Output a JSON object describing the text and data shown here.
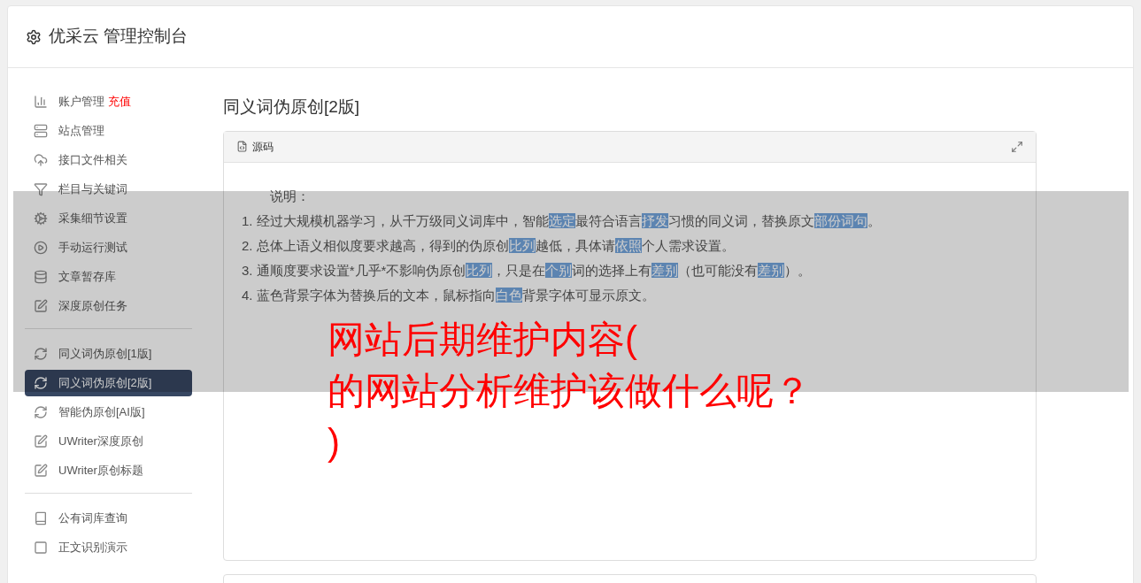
{
  "header": {
    "title": "优采云 管理控制台"
  },
  "sidebar": {
    "groups": [
      [
        {
          "kind": "chart",
          "label": "账户管理",
          "badge": "充值",
          "selected": false
        },
        {
          "kind": "server",
          "label": "站点管理",
          "selected": false
        },
        {
          "kind": "cloud",
          "label": "接口文件相关",
          "selected": false
        },
        {
          "kind": "filter",
          "label": "栏目与关键词",
          "selected": false
        },
        {
          "kind": "gears",
          "label": "采集细节设置",
          "selected": false
        },
        {
          "kind": "play",
          "label": "手动运行测试",
          "selected": false
        },
        {
          "kind": "database",
          "label": "文章暂存库",
          "selected": false
        },
        {
          "kind": "edit",
          "label": "深度原创任务",
          "selected": false
        }
      ],
      [
        {
          "kind": "refresh",
          "label": "同义词伪原创[1版]",
          "selected": false
        },
        {
          "kind": "refresh",
          "label": "同义词伪原创[2版]",
          "selected": true
        },
        {
          "kind": "refresh",
          "label": "智能伪原创[AI版]",
          "selected": false
        },
        {
          "kind": "edit",
          "label": "UWriter深度原创",
          "selected": false
        },
        {
          "kind": "edit",
          "label": "UWriter原创标题",
          "selected": false
        }
      ],
      [
        {
          "kind": "book",
          "label": "公有词库查询",
          "selected": false
        },
        {
          "kind": "square",
          "label": "正文识别演示",
          "selected": false
        }
      ]
    ]
  },
  "main": {
    "title": "同义词伪原创[2版]",
    "panel": {
      "tab": "源码",
      "heading": "说明：",
      "lines": [
        [
          {
            "text": "1. 经过大规模机器学习，从千万级同义词库中，智能",
            "highlighted": false
          },
          {
            "text": "选定",
            "highlighted": true
          },
          {
            "text": "最符合语言",
            "highlighted": false
          },
          {
            "text": "抒发",
            "highlighted": true
          },
          {
            "text": "习惯的同义词，替换原文",
            "highlighted": false
          },
          {
            "text": "部份",
            "highlighted": true
          },
          {
            "text": "词句",
            "highlighted": true
          },
          {
            "text": "。",
            "highlighted": false
          }
        ],
        [
          {
            "text": "2. 总体上语义相似度要求越高，得到的伪原创",
            "highlighted": false
          },
          {
            "text": "比列",
            "highlighted": true
          },
          {
            "text": "越低，具体请",
            "highlighted": false
          },
          {
            "text": "依照",
            "highlighted": true
          },
          {
            "text": "个人需求设置。",
            "highlighted": false
          }
        ],
        [
          {
            "text": "3. 通顺度要求设置*几乎*不影响伪原创",
            "highlighted": false
          },
          {
            "text": "比列",
            "highlighted": true
          },
          {
            "text": "，只是在",
            "highlighted": false
          },
          {
            "text": "个别",
            "highlighted": true
          },
          {
            "text": "词的选择上有",
            "highlighted": false
          },
          {
            "text": "差别",
            "highlighted": true
          },
          {
            "text": "（也可能没有",
            "highlighted": false
          },
          {
            "text": "差别",
            "highlighted": true
          },
          {
            "text": "）。",
            "highlighted": false
          }
        ],
        [
          {
            "text": "4. 蓝色背景字体为替换后的文本，鼠标指向",
            "highlighted": false
          },
          {
            "text": "白色",
            "highlighted": true
          },
          {
            "text": "背景字体可显示原文。",
            "highlighted": false
          }
        ]
      ]
    }
  },
  "overlay": {
    "lines": [
      "网站后期维护内容(",
      "的网站分析维护该做什么呢？",
      ")"
    ]
  }
}
